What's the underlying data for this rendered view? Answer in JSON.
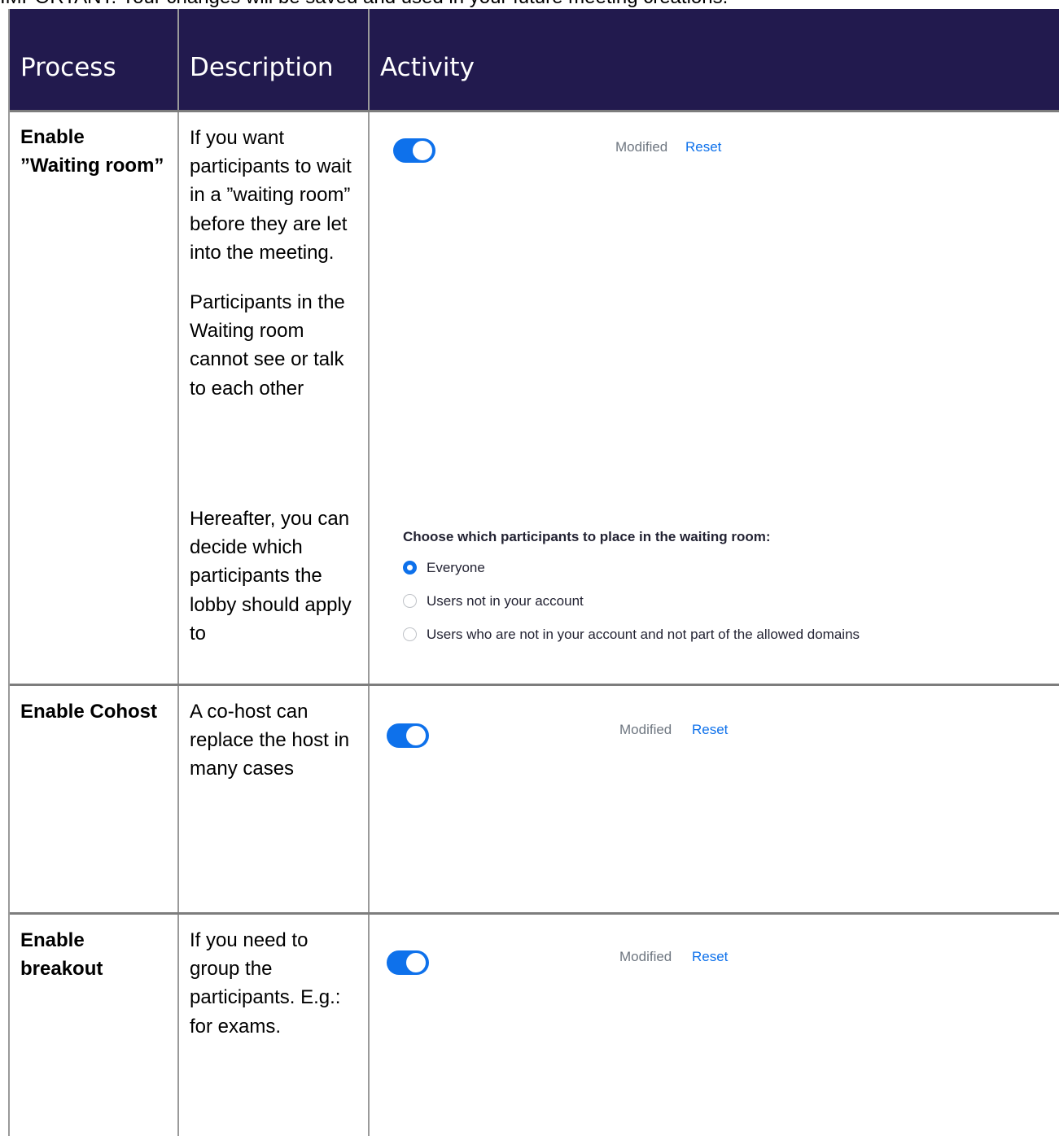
{
  "intro_text": "IMPORTANT: Your changes will be saved and used in your future meeting creations.",
  "header": {
    "process": "Process",
    "description": "Description",
    "activity": "Activity"
  },
  "rows": [
    {
      "process": "Enable ”Waiting room”",
      "description": [
        "If you want participants to wait in a ”waiting room” before they are let into the meeting.",
        "Participants in the Waiting room cannot see or talk to each other",
        "Hereafter, you can decide which participants the lobby should apply to"
      ],
      "toggle_on": true,
      "modified": "Modified",
      "reset": "Reset",
      "options_title": "Choose which participants to place in the waiting room:",
      "options": [
        {
          "label": "Everyone",
          "checked": true
        },
        {
          "label": "Users not in your account",
          "checked": false
        },
        {
          "label": "Users who are not in your account and not part of the allowed domains",
          "checked": false
        }
      ]
    },
    {
      "process": "Enable Cohost",
      "description": [
        "A co-host can replace the host in many cases"
      ],
      "toggle_on": true,
      "modified": "Modified",
      "reset": "Reset"
    },
    {
      "process": "Enable breakout",
      "description": [
        "If you need to group the participants. E.g.: for exams."
      ],
      "toggle_on": true,
      "modified": "Modified",
      "reset": "Reset"
    }
  ],
  "colors": {
    "header_bg": "#221a4e",
    "toggle_blue": "#0e71eb",
    "muted_text": "#6e7680"
  }
}
